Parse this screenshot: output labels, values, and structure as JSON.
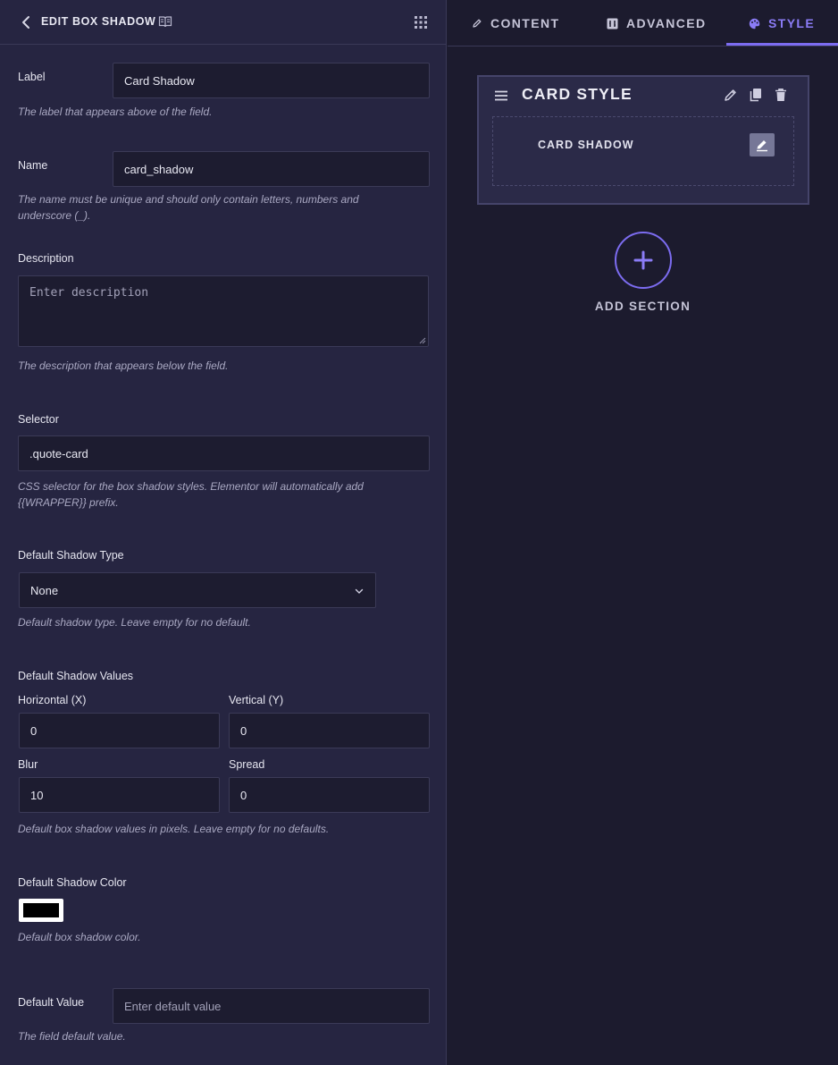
{
  "header": {
    "title": "EDIT BOX SHADOW"
  },
  "fields": {
    "label": {
      "label": "Label",
      "value": "Card Shadow",
      "help": "The label that appears above of the field."
    },
    "name": {
      "label": "Name",
      "value": "card_shadow",
      "help_line1": "The name must be unique and should only contain letters, numbers and",
      "help_line2": "underscore (_)."
    },
    "description": {
      "label": "Description",
      "placeholder": "Enter description",
      "help": "The description that appears below the field."
    },
    "selector": {
      "label": "Selector",
      "value": ".quote-card",
      "help_line1": "CSS selector for the box shadow styles. Elementor will automatically add",
      "help_line2": "{{WRAPPER}} prefix."
    },
    "shadow_type": {
      "label": "Default Shadow Type",
      "selected": "None",
      "help": "Default shadow type. Leave empty for no default."
    },
    "shadow_values": {
      "label": "Default Shadow Values",
      "horizontal": {
        "label": "Horizontal (X)",
        "value": "0"
      },
      "vertical": {
        "label": "Vertical (Y)",
        "value": "0"
      },
      "blur": {
        "label": "Blur",
        "value": "10"
      },
      "spread": {
        "label": "Spread",
        "value": "0"
      },
      "help": "Default box shadow values in pixels. Leave empty for no defaults."
    },
    "shadow_color": {
      "label": "Default Shadow Color",
      "color": "#000000",
      "help": "Default box shadow color."
    },
    "default_value": {
      "label": "Default Value",
      "placeholder": "Enter default value",
      "help": "The field default value."
    }
  },
  "tabs": [
    {
      "label": "CONTENT",
      "icon": "pencil-icon"
    },
    {
      "label": "ADVANCED",
      "icon": "advanced-icon"
    },
    {
      "label": "STYLE",
      "icon": "palette-icon",
      "active": true
    }
  ],
  "section": {
    "title": "CARD STYLE",
    "field": "CARD SHADOW"
  },
  "add_section": {
    "label": "ADD SECTION"
  },
  "colors": {
    "accent": "#7c6cf0",
    "panel": "#262541",
    "canvas": "#1c1b2e"
  }
}
